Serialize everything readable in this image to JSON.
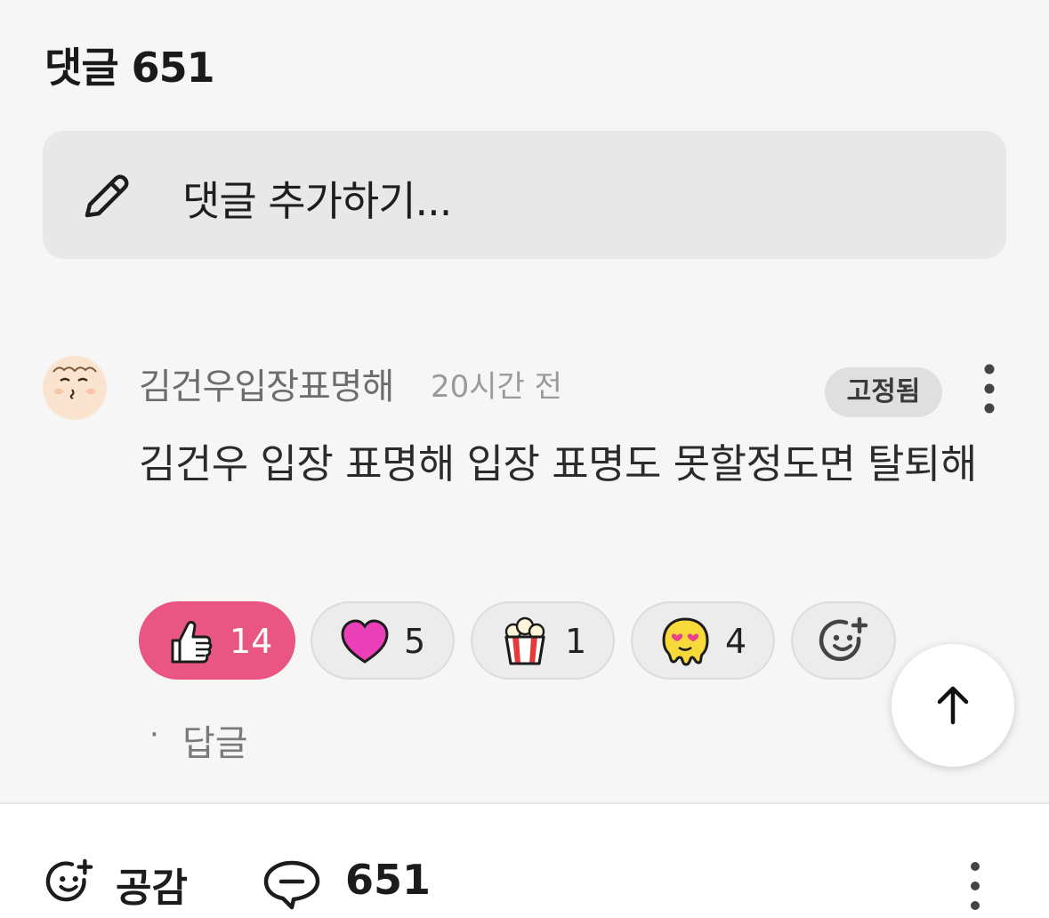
{
  "comments": {
    "title": "댓글 651",
    "input_placeholder": "댓글 추가하기..."
  },
  "comment": {
    "author": "김건우입장표명해",
    "time": "20시간 전",
    "pinned_label": "고정됨",
    "body": "김건우 입장 표명해 입장 표명도 못할정도면 탈퇴해",
    "reply_label": "답글",
    "reactions": [
      {
        "icon": "thumbs-up-icon",
        "count": "14",
        "active": true
      },
      {
        "icon": "heart-icon",
        "count": "5",
        "active": false
      },
      {
        "icon": "popcorn-icon",
        "count": "1",
        "active": false
      },
      {
        "icon": "melting-heart-eyes-icon",
        "count": "4",
        "active": false
      },
      {
        "icon": "add-reaction-icon",
        "active": false
      }
    ]
  },
  "bottom_bar": {
    "like_label": "공감",
    "comment_count": "651"
  },
  "colors": {
    "active_reaction": "#ea5683",
    "background": "#f6f6f6",
    "input_background": "#e8e8e8"
  }
}
